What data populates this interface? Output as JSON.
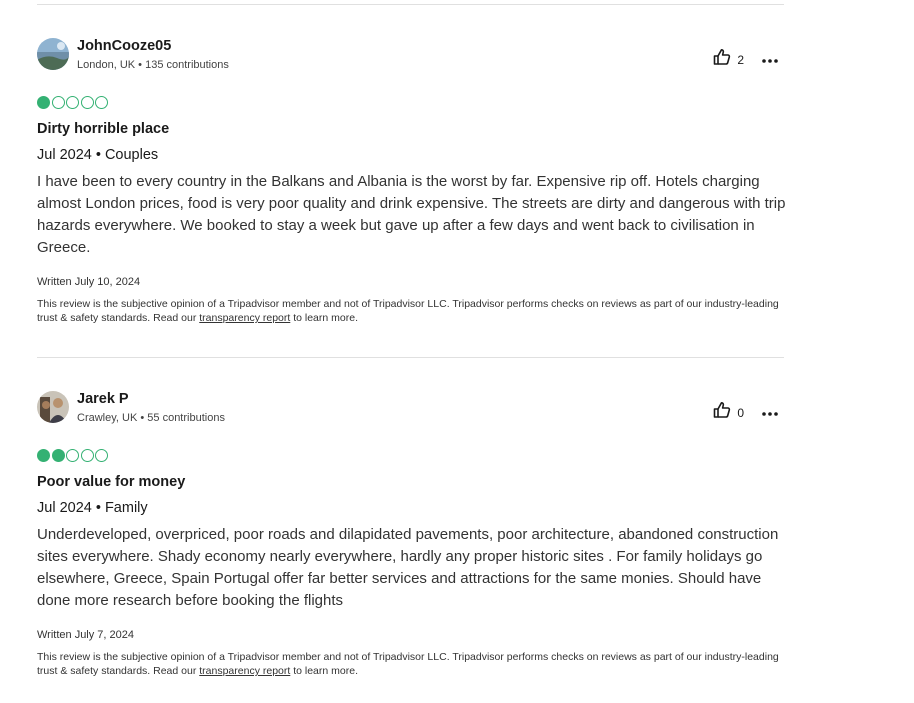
{
  "reviews": [
    {
      "username": "JohnCooze05",
      "location": "London, UK",
      "contributions": "135 contributions",
      "helpful_votes": "2",
      "rating": 1,
      "title": "Dirty horrible place",
      "trip": "Jul 2024 • Couples",
      "body": "I have been to every country in the Balkans and Albania is the worst by far. Expensive rip off. Hotels charging almost London prices, food is very poor quality and drink expensive. The streets are dirty and dangerous with trip hazards everywhere. We booked to stay a week but gave up after a few days and went back to civilisation in Greece.",
      "written": "Written July 10, 2024",
      "disclaimer_pre": "This review is the subjective opinion of a Tripadvisor member and not of Tripadvisor LLC. Tripadvisor performs checks on reviews as part of our industry-leading trust & safety standards. Read our ",
      "disclaimer_link": "transparency report",
      "disclaimer_post": " to learn more."
    },
    {
      "username": "Jarek P",
      "location": "Crawley, UK",
      "contributions": "55 contributions",
      "helpful_votes": "0",
      "rating": 2,
      "title": "Poor value for money",
      "trip": "Jul 2024 • Family",
      "body": "Underdeveloped, overpriced, poor roads and dilapidated pavements, poor architecture, abandoned construction sites everywhere. Shady economy nearly everywhere, hardly any proper historic sites . For family holidays go elsewhere, Greece, Spain Portugal offer far better services and attractions for the same monies. Should have done more research before booking the flights",
      "written": "Written July 7, 2024",
      "disclaimer_pre": "This review is the subjective opinion of a Tripadvisor member and not of Tripadvisor LLC. Tripadvisor performs checks on reviews as part of our industry-leading trust & safety standards. Read our ",
      "disclaimer_link": "transparency report",
      "disclaimer_post": " to learn more."
    }
  ],
  "meta_separator": " • ",
  "colors": {
    "bubble": "#34b173",
    "divider": "#e0e0e0"
  },
  "icons": {
    "helpful": "thumbs-up-icon",
    "more": "more-options-icon"
  }
}
